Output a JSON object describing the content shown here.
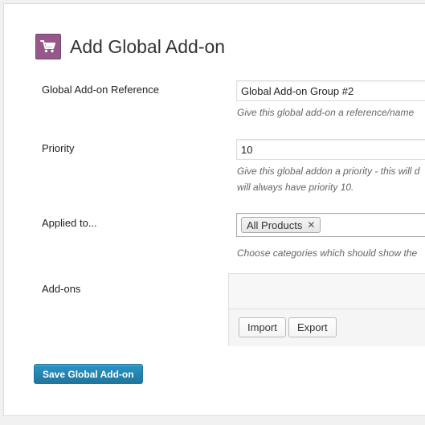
{
  "page": {
    "title": "Add Global Add-on",
    "icon": "shopping-cart-icon",
    "icon_color": "#96588a"
  },
  "fields": {
    "reference": {
      "label": "Global Add-on Reference",
      "value": "Global Add-on Group #2",
      "description": "Give this global add-on a reference/name"
    },
    "priority": {
      "label": "Priority",
      "value": "10",
      "description_line1": "Give this global addon a priority - this will d",
      "description_line2": "will always have priority 10."
    },
    "applied_to": {
      "label": "Applied to...",
      "selected_tag": "All Products",
      "remove_symbol": "✕",
      "description": "Choose categories which should show the"
    },
    "addons": {
      "label": "Add-ons",
      "import_label": "Import",
      "export_label": "Export"
    }
  },
  "save_button": {
    "label": "Save Global Add-on",
    "color": "#21759b"
  }
}
